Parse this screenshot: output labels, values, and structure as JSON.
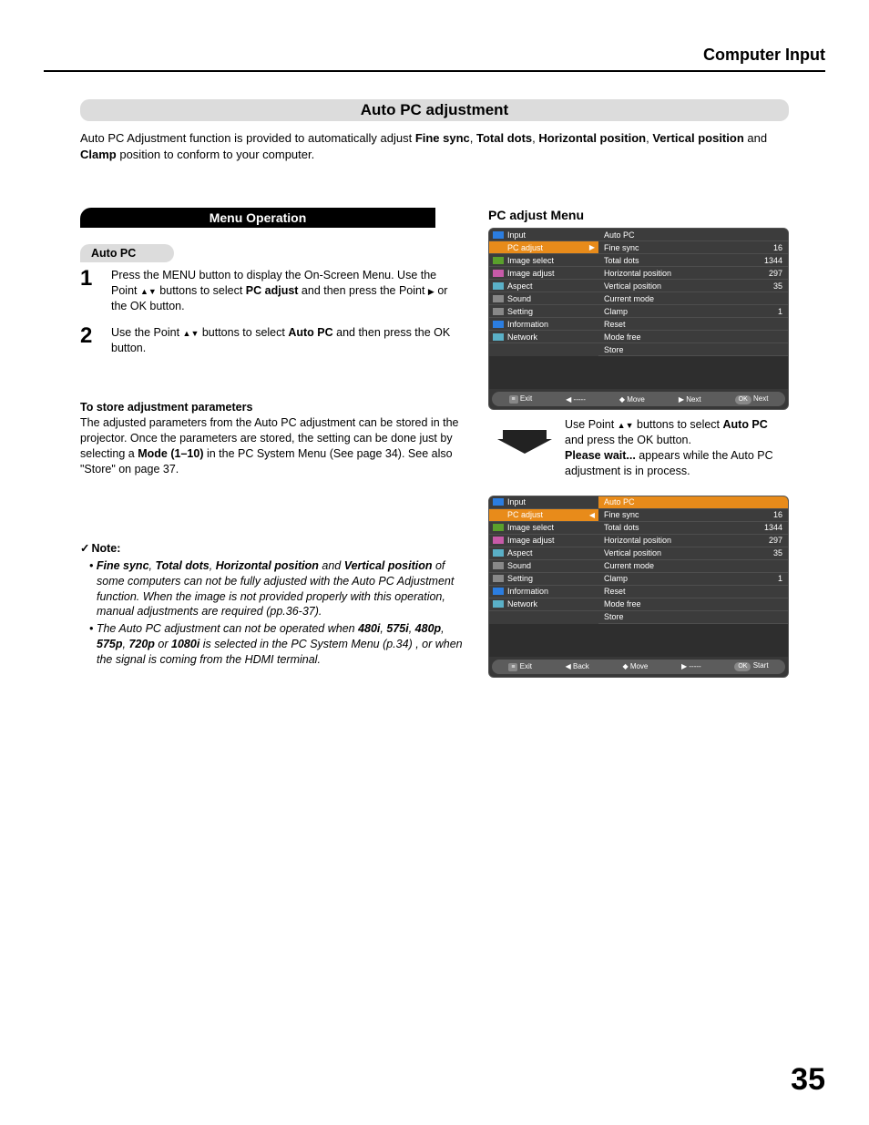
{
  "header": {
    "section": "Computer Input"
  },
  "title": "Auto PC adjustment",
  "intro": {
    "a": "Auto PC Adjustment function is provided to automatically adjust ",
    "b": "Fine sync",
    "c": ", ",
    "d": "Total dots",
    "e": ", ",
    "f": "Horizontal position",
    "g": ", ",
    "h": "Vertical position",
    "i": " and ",
    "j": "Clamp",
    "k": " position to conform to your computer."
  },
  "menu_operation": "Menu Operation",
  "autopc_label": "Auto PC",
  "steps": {
    "s1n": "1",
    "s1a": "Press the MENU button to display the On-Screen Menu. Use the Point ",
    "s1b": " buttons to select ",
    "s1c": "PC adjust",
    "s1d": " and then press the Point ",
    "s1e": " or the OK button.",
    "s2n": "2",
    "s2a": "Use the Point ",
    "s2b": " buttons to select ",
    "s2c": "Auto PC",
    "s2d": " and then press the OK button."
  },
  "store": {
    "head": "To store adjustment parameters",
    "a": "The adjusted parameters from the Auto PC adjustment can be stored in the projector. Once the parameters are stored, the setting can be done just by selecting a ",
    "b": "Mode (1–10)",
    "c": " in the PC System Menu (See page 34). See also \"Store\" on page 37."
  },
  "note": {
    "head": "Note:",
    "n1a": "• ",
    "n1b": "Fine sync",
    "n1c": ", ",
    "n1d": "Total dots",
    "n1e": ", ",
    "n1f": "Horizontal position",
    "n1g": " and ",
    "n1h": "Vertical position",
    "n1i": " of some computers can not be fully adjusted with the Auto PC Adjustment function. When the image is not provided properly with this operation, manual adjustments are required (pp.36-37).",
    "n2a": "• The Auto PC adjustment can not be operated when ",
    "n2b": "480i",
    "n2c": ", ",
    "n2d": "575i",
    "n2e": ", ",
    "n2f": "480p",
    "n2g": ", ",
    "n2h": "575p",
    "n2i": ", ",
    "n2j": "720p",
    "n2k": " or ",
    "n2l": "1080i",
    "n2m": " is selected in the PC System Menu (p.34) , or when the signal is coming from the HDMI terminal."
  },
  "right_head": "PC adjust Menu",
  "menu_left": [
    "Input",
    "PC adjust",
    "Image select",
    "Image adjust",
    "Aspect",
    "Sound",
    "Setting",
    "Information",
    "Network"
  ],
  "menu_right1": [
    {
      "l": "Auto PC",
      "v": ""
    },
    {
      "l": "Fine sync",
      "v": "16"
    },
    {
      "l": "Total dots",
      "v": "1344"
    },
    {
      "l": "Horizontal position",
      "v": "297"
    },
    {
      "l": "Vertical position",
      "v": "35"
    },
    {
      "l": "Current mode",
      "v": ""
    },
    {
      "l": "Clamp",
      "v": "1"
    },
    {
      "l": "Reset",
      "v": ""
    },
    {
      "l": "Mode free",
      "v": ""
    },
    {
      "l": "Store",
      "v": ""
    }
  ],
  "footer1": {
    "exit": "Exit",
    "back": "-----",
    "move": "Move",
    "next": "Next",
    "ok": "OK",
    "okl": "Next"
  },
  "footer2": {
    "exit": "Exit",
    "back": "Back",
    "move": "Move",
    "next": "-----",
    "ok": "OK",
    "okl": "Start"
  },
  "midtext": {
    "a": "Use Point ",
    "b": " buttons to select ",
    "c": "Auto PC",
    "d": " and press the OK button.",
    "e": "Please wait...",
    "f": " appears while the Auto PC adjustment is in process."
  },
  "page": "35"
}
